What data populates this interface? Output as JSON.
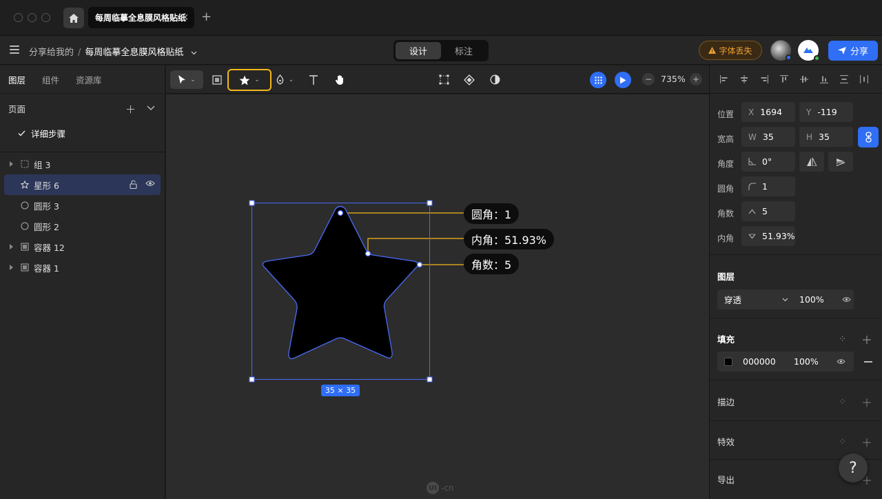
{
  "app": {
    "tab_title": "每周临摹全息膜风格贴纸",
    "new_tab_symbol": "+",
    "close_symbol": "×"
  },
  "docbar": {
    "breadcrumb_parent": "分享给我的",
    "breadcrumb_sep": "/",
    "breadcrumb_current": "每周临摹全息膜风格贴纸",
    "modes": [
      "设计",
      "标注"
    ],
    "active_mode": "设计",
    "font_missing_label": "字体丢失",
    "share_label": "分享",
    "colors": {
      "accent": "#2f6ef5",
      "warning": "#f0a030",
      "highlight": "#f5b81a"
    }
  },
  "left_panel": {
    "tabs": [
      "图层",
      "组件",
      "资源库"
    ],
    "active_tab": "图层",
    "pages_title": "页面",
    "pages": [
      {
        "label": "详细步骤",
        "checked": true
      }
    ],
    "layers": [
      {
        "label": "组 3",
        "icon": "group-icon",
        "expandable": true,
        "selected": false
      },
      {
        "label": "星形 6",
        "icon": "star-icon",
        "expandable": false,
        "selected": true
      },
      {
        "label": "圆形 3",
        "icon": "circle-icon",
        "expandable": false,
        "selected": false
      },
      {
        "label": "圆形 2",
        "icon": "circle-icon",
        "expandable": false,
        "selected": false
      },
      {
        "label": "容器 12",
        "icon": "frame-icon",
        "expandable": true,
        "selected": false
      },
      {
        "label": "容器 1",
        "icon": "frame-icon",
        "expandable": true,
        "selected": false
      }
    ]
  },
  "toolbar": {
    "zoom": "735%",
    "zoom_minus": "−",
    "zoom_plus": "+"
  },
  "canvas": {
    "callouts": {
      "corner": "圆角：1",
      "inner": "内角：51.93%",
      "points": "角数：5"
    },
    "dimensions": "35 × 35",
    "watermark": "-cn",
    "watermark_badge": "UI",
    "shape_fill": "#000000"
  },
  "right_panel": {
    "labels": {
      "position": "位置",
      "size": "宽高",
      "angle": "角度",
      "corner": "圆角",
      "points": "角数",
      "inner": "内角"
    },
    "x_key": "X",
    "x": "1694",
    "y_key": "Y",
    "y": "-119",
    "w_key": "W",
    "w": "35",
    "h_key": "H",
    "h": "35",
    "angle": "0°",
    "corner_radius": "1",
    "point_count": "5",
    "inner_ratio": "51.93%",
    "layer_section": "图层",
    "blend_mode": "穿透",
    "layer_opacity": "100%",
    "fill_section": "填充",
    "fill_hex": "000000",
    "fill_opacity": "100%",
    "stroke_section": "描边",
    "effects_section": "特效",
    "export_section": "导出",
    "help": "?"
  }
}
